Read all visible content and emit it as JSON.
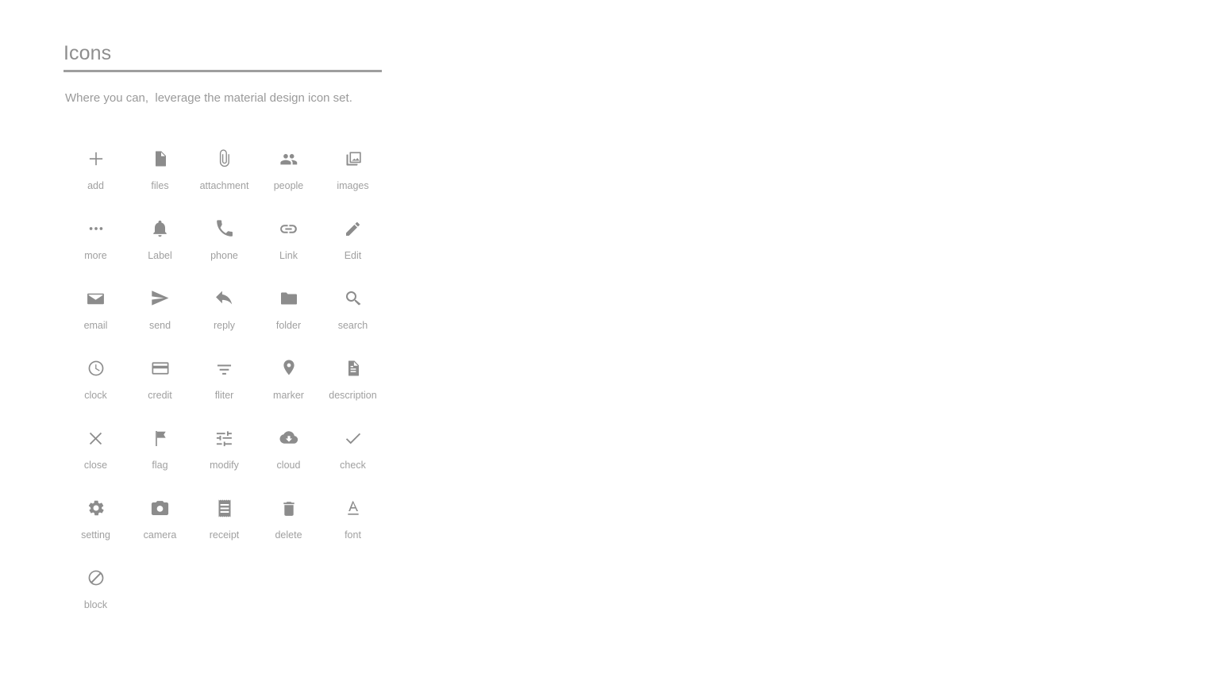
{
  "header": {
    "title": "Icons",
    "subtitle": "Where you can,  leverage the material design icon set."
  },
  "colors": {
    "title_text": "#8e8e8e",
    "rule": "#9e9e9e",
    "subtitle_text": "#9a9a9a",
    "icon_fill": "#8c8c8c",
    "label_text": "#a0a0a0",
    "background": "#ffffff"
  },
  "icons": [
    {
      "label": "add",
      "icon": "add-icon"
    },
    {
      "label": "files",
      "icon": "file-icon"
    },
    {
      "label": "attachment",
      "icon": "paperclip-icon"
    },
    {
      "label": "people",
      "icon": "people-icon"
    },
    {
      "label": "images",
      "icon": "photo-library-icon"
    },
    {
      "label": "more",
      "icon": "more-horizontal-icon"
    },
    {
      "label": "Label",
      "icon": "bell-icon"
    },
    {
      "label": "phone",
      "icon": "phone-icon"
    },
    {
      "label": "Link",
      "icon": "link-icon"
    },
    {
      "label": "Edit",
      "icon": "pencil-icon"
    },
    {
      "label": "email",
      "icon": "envelope-icon"
    },
    {
      "label": "send",
      "icon": "send-icon"
    },
    {
      "label": "reply",
      "icon": "reply-icon"
    },
    {
      "label": "folder",
      "icon": "folder-icon"
    },
    {
      "label": "search",
      "icon": "search-icon"
    },
    {
      "label": "clock",
      "icon": "clock-icon"
    },
    {
      "label": "credit",
      "icon": "credit-card-icon"
    },
    {
      "label": "fliter",
      "icon": "filter-list-icon"
    },
    {
      "label": "marker",
      "icon": "map-pin-icon"
    },
    {
      "label": "description",
      "icon": "description-icon"
    },
    {
      "label": "close",
      "icon": "close-icon"
    },
    {
      "label": "flag",
      "icon": "flag-icon"
    },
    {
      "label": "modify",
      "icon": "tune-icon"
    },
    {
      "label": "cloud",
      "icon": "cloud-download-icon"
    },
    {
      "label": "check",
      "icon": "check-icon"
    },
    {
      "label": "setting",
      "icon": "gear-icon"
    },
    {
      "label": "camera",
      "icon": "camera-icon"
    },
    {
      "label": "receipt",
      "icon": "receipt-icon"
    },
    {
      "label": "delete",
      "icon": "trash-icon"
    },
    {
      "label": "font",
      "icon": "font-underline-icon"
    },
    {
      "label": "block",
      "icon": "block-icon"
    }
  ]
}
